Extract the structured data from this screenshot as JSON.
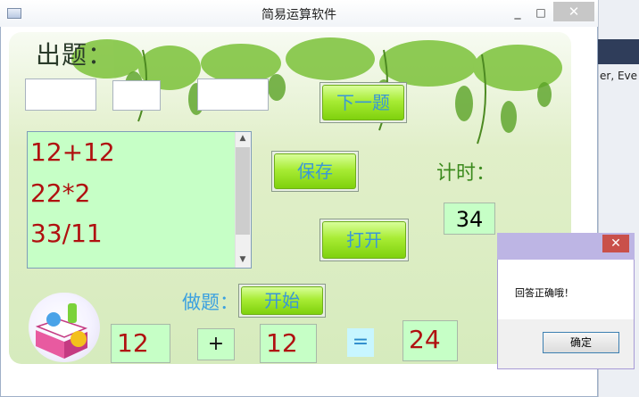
{
  "window": {
    "title": "简易运算软件",
    "minimize_glyph": "_",
    "maximize_glyph": "□",
    "close_glyph": "✕"
  },
  "labels": {
    "chuti": "出题：",
    "timer": "计时：",
    "zuoti": "做题："
  },
  "inputs": {
    "operand1": "",
    "operator": "",
    "operand2": ""
  },
  "buttons": {
    "next": "下一题",
    "save": "保存",
    "open": "打开",
    "start": "开始"
  },
  "question_list": [
    "12+12",
    "22*2",
    "33/11"
  ],
  "timer_value": "34",
  "answer_row": {
    "operand1": "12",
    "operator": "+",
    "operand2": "12",
    "equals": "=",
    "answer": "24"
  },
  "message_box": {
    "text": "回答正确哦！",
    "ok_label": "确定",
    "close_glyph": "✕"
  },
  "background_app": {
    "text": "er, Eve"
  },
  "colors": {
    "question_text": "#b01010",
    "button_text": "#3a97d6",
    "list_bg": "#c6ffc6",
    "button_green": "#a8ec34"
  }
}
